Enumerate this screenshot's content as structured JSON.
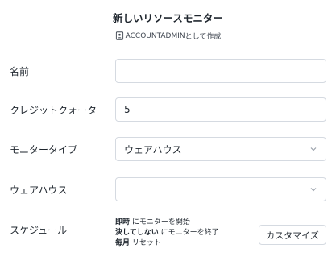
{
  "dialog": {
    "title": "新しいリソースモニター",
    "owner_role": "ACCOUNTADMIN",
    "owner_suffix": "として作成"
  },
  "form": {
    "name": {
      "label": "名前",
      "value": ""
    },
    "credit_quota": {
      "label": "クレジットクォータ",
      "value": "5"
    },
    "monitor_type": {
      "label": "モニタータイプ",
      "value": "ウェアハウス"
    },
    "warehouse": {
      "label": "ウェアハウス",
      "value": ""
    },
    "schedule": {
      "label": "スケジュール",
      "line1_bold": "即時",
      "line1_rest": "にモニターを開始",
      "line2_bold": "決してしない",
      "line2_rest": "にモニターを終了",
      "line3_bold": "毎月",
      "line3_rest": "リセット",
      "customize_label": "カスタマイズ"
    }
  },
  "icons": {
    "role": "user-badge-icon",
    "dropdown": "chevron-down-icon"
  },
  "colors": {
    "text": "#1e252d",
    "border": "#d5dae1",
    "muted": "#3f4650",
    "chevron": "#9aa1ab"
  }
}
